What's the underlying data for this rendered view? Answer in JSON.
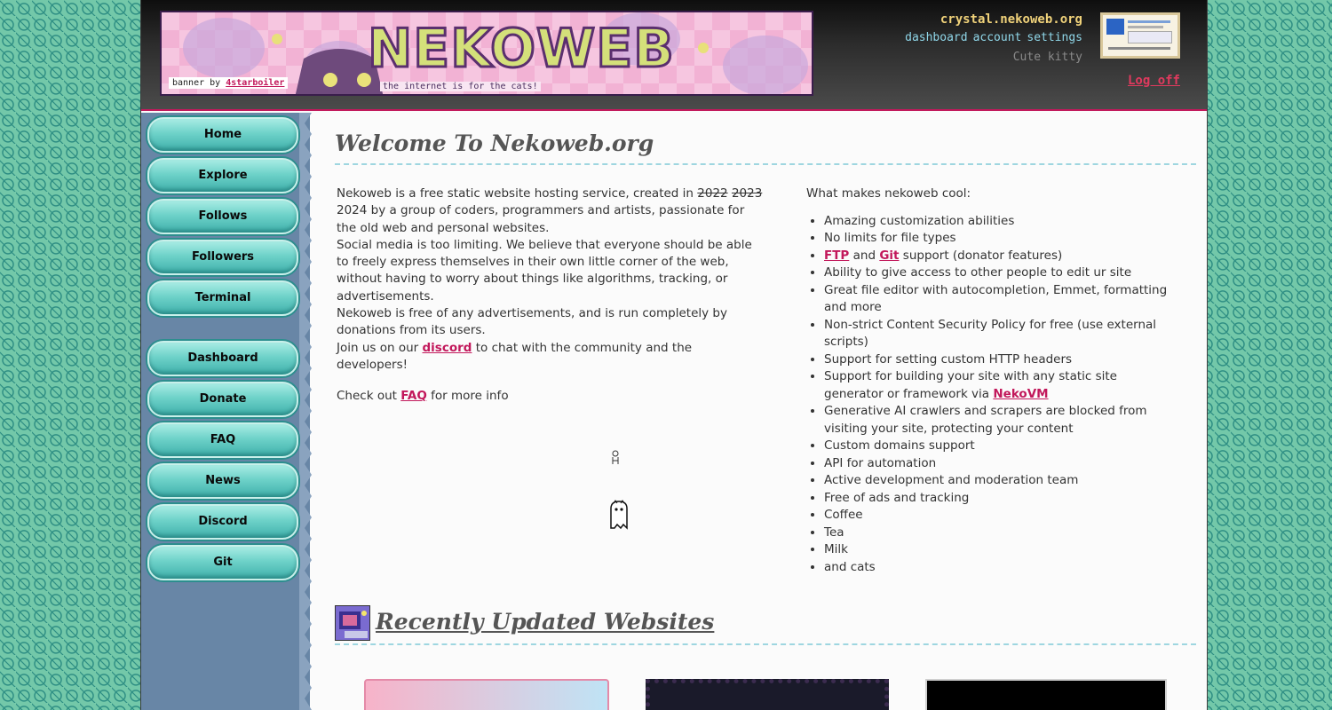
{
  "header": {
    "banner": {
      "logo_text": "NEKOWEB",
      "tagline": "the internet is for the cats!",
      "credit_prefix": "banner by",
      "credit_author": "4starboiler"
    },
    "account": {
      "domain": "crystal.nekoweb.org",
      "links": [
        "dashboard",
        "account",
        "settings"
      ],
      "status": "Cute kitty",
      "logoff": "Log off"
    }
  },
  "sidebar": {
    "items": [
      "Home",
      "Explore",
      "Follows",
      "Followers",
      "Terminal",
      "Dashboard",
      "Donate",
      "FAQ",
      "News",
      "Discord",
      "Git"
    ]
  },
  "main": {
    "title": "Welcome To Nekoweb.org",
    "intro": {
      "p1_a": "Nekoweb is a free static website hosting service, created in",
      "struck_1": "2022",
      "struck_2": "2023",
      "p1_b": "2024 by a group of coders, programmers and artists, passionate for the old web and personal websites.",
      "p2": "Social media is too limiting. We believe that everyone should be able to freely express themselves in their own little corner of the web, without having to worry about things like algorithms, tracking, or advertisements.",
      "p3": "Nekoweb is free of any advertisements, and is run completely by donations from its users.",
      "p4_a": "Join us on our",
      "p4_link": "discord",
      "p4_b": "to chat with the community and the developers!",
      "p5_a": "Check out",
      "p5_link": "FAQ",
      "p5_b": "for more info"
    },
    "features_title": "What makes nekoweb cool:",
    "features": {
      "f1": "Amazing customization abilities",
      "f2": "No limits for file types",
      "f3_ftp": "FTP",
      "f3_and": "and",
      "f3_git": "Git",
      "f3_rest": "support (donator features)",
      "f4": "Ability to give access to other people to edit ur site",
      "f5": "Great file editor with autocompletion, Emmet, formatting and more",
      "f6": "Non-strict Content Security Policy for free (use external scripts)",
      "f7": "Support for setting custom HTTP headers",
      "f8_a": "Support for building your site with any static site generator or framework via",
      "f8_link": "NekoVM",
      "f9": "Generative AI crawlers and scrapers are blocked from visiting your site, protecting your content",
      "f10": "Custom domains support",
      "f11": "API for automation",
      "f12": "Active development and moderation team",
      "f13": "Free of ads and tracking",
      "f14": "Coffee",
      "f15": "Tea",
      "f16": "Milk",
      "f17": "and cats"
    },
    "recent_title": "Recently Updated Websites"
  },
  "colors": {
    "accent": "#c2185b",
    "sidebar_bg": "#6886a6",
    "button": "#6ed2c9",
    "link_header": "#8fd6e8",
    "domain": "#f0d27a"
  }
}
